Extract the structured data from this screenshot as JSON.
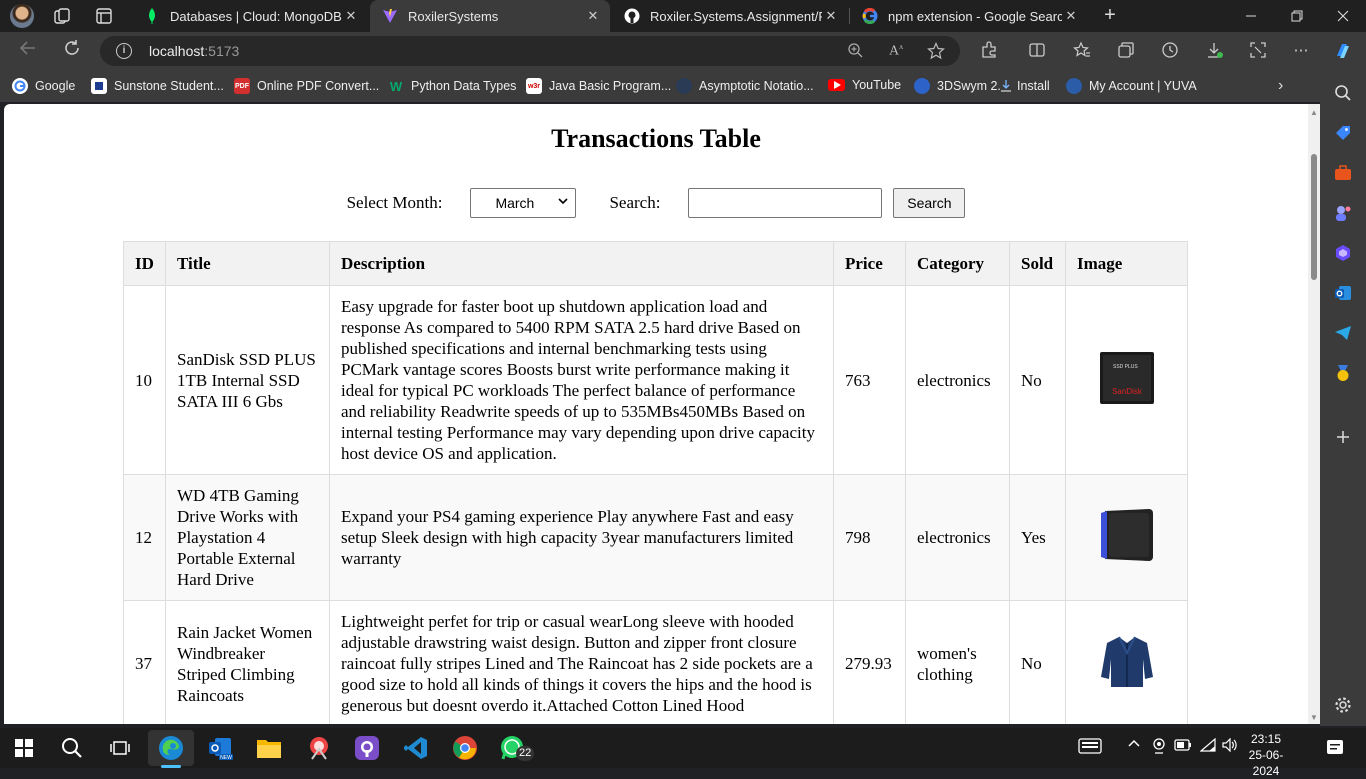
{
  "browser": {
    "tabs": [
      {
        "label": "Databases | Cloud: MongoDB Clo",
        "icon": "mongodb-leaf-icon",
        "active": false
      },
      {
        "label": "RoxilerSystems",
        "icon": "vite-icon",
        "active": true
      },
      {
        "label": "Roxiler.Systems.Assignment/REA",
        "icon": "github-icon",
        "active": false
      },
      {
        "label": "npm extension - Google Search",
        "icon": "google-icon",
        "active": false
      }
    ],
    "url_host": "localhost",
    "url_port": ":5173",
    "bookmarks": [
      {
        "label": "Google",
        "icon": "google-icon"
      },
      {
        "label": "Sunstone Student...",
        "icon": "sunstone-icon"
      },
      {
        "label": "Online PDF Convert...",
        "icon": "pdf-icon"
      },
      {
        "label": "Python Data Types",
        "icon": "w3schools-icon"
      },
      {
        "label": "Java Basic Program...",
        "icon": "w3resource-icon"
      },
      {
        "label": "Asymptotic Notatio...",
        "icon": "globe-icon"
      },
      {
        "label": "YouTube",
        "icon": "youtube-icon"
      },
      {
        "label": "3DSwym 2.",
        "icon": "3dswym-icon"
      },
      {
        "label": "Install",
        "icon": "install-icon"
      },
      {
        "label": "My Account | YUVA",
        "icon": "yuva-icon"
      }
    ],
    "tab_close": "✕",
    "pdf_icon_text": "PDF",
    "w3_icon_text": "W",
    "w3r_icon_text": "w3r"
  },
  "page": {
    "title": "Transactions Table",
    "select_month_label": "Select Month:",
    "selected_month": "March",
    "search_label": "Search:",
    "search_value": "",
    "search_button": "Search",
    "columns": [
      "ID",
      "Title",
      "Description",
      "Price",
      "Category",
      "Sold",
      "Image"
    ],
    "rows": [
      {
        "id": "10",
        "title": "SanDisk SSD PLUS 1TB Internal SSD SATA III 6 Gbs",
        "description": "Easy upgrade for faster boot up shutdown application load and response As compared to 5400 RPM SATA 2.5 hard drive Based on published specifications and internal benchmarking tests using PCMark vantage scores Boosts burst write performance making it ideal for typical PC workloads The perfect balance of performance and reliability Readwrite speeds of up to 535MBs450MBs Based on internal testing Performance may vary depending upon drive capacity host device OS and application.",
        "price": "763",
        "category": "electronics",
        "sold": "No",
        "image": "ssd-image",
        "image_label": "SanDisk",
        "image_sublabel": "SSD PLUS"
      },
      {
        "id": "12",
        "title": "WD 4TB Gaming Drive Works with Playstation 4 Portable External Hard Drive",
        "description": "Expand your PS4 gaming experience Play anywhere Fast and easy setup Sleek design with high capacity 3year manufacturers limited warranty",
        "price": "798",
        "category": "electronics",
        "sold": "Yes",
        "image": "hard-drive-image"
      },
      {
        "id": "37",
        "title": "Rain Jacket Women Windbreaker Striped Climbing Raincoats",
        "description": "Lightweight perfet for trip or casual wearLong sleeve with hooded adjustable drawstring waist design. Button and zipper front closure raincoat fully stripes Lined and The Raincoat has 2 side pockets are a good size to hold all kinds of things it covers the hips and the hood is generous but doesnt overdo it.Attached Cotton Lined Hood",
        "price": "279.93",
        "category": "women's clothing",
        "sold": "No",
        "image": "jacket-image"
      }
    ]
  },
  "taskbar": {
    "time": "23:15",
    "date": "25-06-2024",
    "whatsapp_badge": "22",
    "outlook_badge": "NEW"
  }
}
